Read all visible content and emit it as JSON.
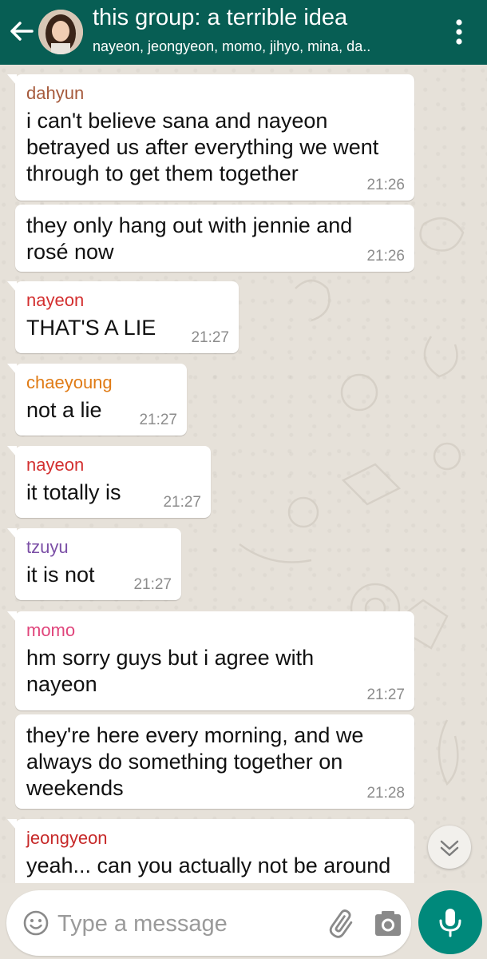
{
  "header": {
    "title": "this group: a terrible idea",
    "subtitle": "nayeon, jeongyeon, momo, jihyo, mina, da.."
  },
  "messages": [
    {
      "sender": "dahyun",
      "sender_color": "#a65a3c",
      "text": "i can't believe sana and nayeon betrayed us after everything we went through to get them together",
      "time": "21:26"
    },
    {
      "sender": "",
      "text": "they only hang out with jennie and rosé now",
      "time": "21:26"
    },
    {
      "sender": "nayeon",
      "sender_color": "#d32f2f",
      "text": "THAT'S A LIE",
      "time": "21:27"
    },
    {
      "sender": "chaeyoung",
      "sender_color": "#e07b15",
      "text": "not a lie",
      "time": "21:27"
    },
    {
      "sender": "nayeon",
      "sender_color": "#d32f2f",
      "text": "it totally is",
      "time": "21:27"
    },
    {
      "sender": "tzuyu",
      "sender_color": "#7b4fa6",
      "text": "it is not",
      "time": "21:27"
    },
    {
      "sender": "momo",
      "sender_color": "#e0457b",
      "text": "hm sorry guys but i agree with nayeon",
      "time": "21:27"
    },
    {
      "sender": "",
      "text": "they're here every morning, and we always do something together on weekends",
      "time": "21:28"
    },
    {
      "sender": "jeongyeon",
      "sender_color": "#c62828",
      "text": "yeah... can you actually not be around",
      "time": ""
    }
  ],
  "composer": {
    "placeholder": "Type a message"
  },
  "icons": {
    "back": "arrow-left-icon",
    "menu": "more-vert-icon",
    "scroll": "chevron-double-down-icon",
    "emoji": "emoji-icon",
    "attach": "paperclip-icon",
    "camera": "camera-icon",
    "mic": "microphone-icon"
  },
  "colors": {
    "header": "#075e54",
    "accent": "#00897b",
    "chat_background": "#e6e1d9"
  }
}
